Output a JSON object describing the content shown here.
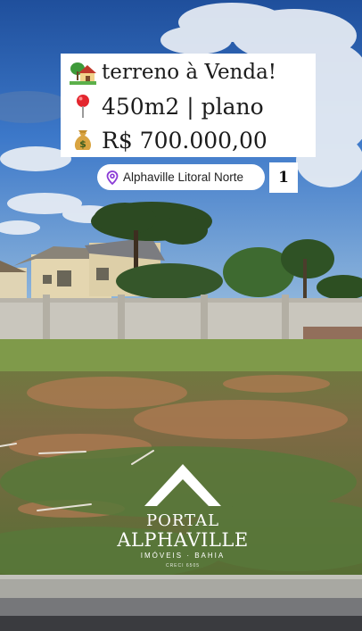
{
  "listing": {
    "line1_text": "terreno à Venda!",
    "line2_text": "450m2 | plano",
    "line3_text": "R$ 700.000,00",
    "line1_icon": "house-with-garden-icon",
    "line2_icon": "round-pushpin-icon",
    "line3_icon": "money-bag-icon"
  },
  "location": {
    "icon": "location-pin-icon",
    "label": "Alphaville Litoral Norte"
  },
  "page_indicator": "1",
  "logo": {
    "icon": "house-roof-icon",
    "line1": "PORTAL",
    "line2": "ALPHAVILLE",
    "line3": "IMÓVEIS · BAHIA",
    "line4": "CRECI 6505"
  },
  "colors": {
    "sky": "#3f78c8",
    "wall": "#c9c7bf",
    "grass": "#5c7a3a",
    "soil": "#a8704a",
    "accent_purple": "#8a3ad6"
  }
}
